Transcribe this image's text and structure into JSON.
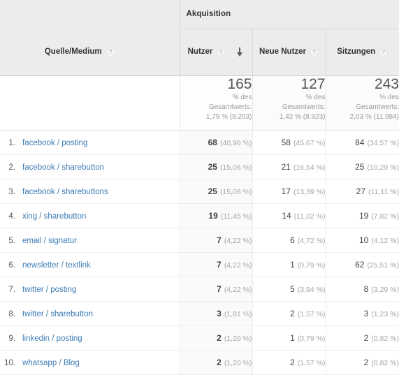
{
  "table": {
    "group_header": {
      "label": "Akquisition"
    },
    "dimension_header": {
      "label": "Quelle/Medium",
      "help_icon": "help-icon"
    },
    "metrics": [
      {
        "label": "Nutzer",
        "help_icon": "help-icon",
        "sorted": true,
        "sort_direction": "descending",
        "sort_icon": "arrow-down-icon"
      },
      {
        "label": "Neue Nutzer",
        "help_icon": "help-icon",
        "sorted": false
      },
      {
        "label": "Sitzungen",
        "help_icon": "help-icon",
        "sorted": false
      }
    ],
    "totals": [
      {
        "value": "165",
        "pct_label": "% des",
        "total_label": "Gesamtwerts:",
        "share": "1,79 % (9.203)"
      },
      {
        "value": "127",
        "pct_label": "% des",
        "total_label": "Gesamtwerts:",
        "share": "1,42 % (8.923)"
      },
      {
        "value": "243",
        "pct_label": "% des",
        "total_label": "Gesamtwerts:",
        "share": "2,03 % (11.984)"
      }
    ],
    "rows": [
      {
        "rank": "1.",
        "source": "facebook / posting",
        "users": "68",
        "users_pct": "(40,96 %)",
        "new_users": "58",
        "new_users_pct": "(45,67 %)",
        "sessions": "84",
        "sessions_pct": "(34,57 %)"
      },
      {
        "rank": "2.",
        "source": "facebook / sharebutton",
        "users": "25",
        "users_pct": "(15,06 %)",
        "new_users": "21",
        "new_users_pct": "(16,54 %)",
        "sessions": "25",
        "sessions_pct": "(10,29 %)"
      },
      {
        "rank": "3.",
        "source": "facebook / sharebuttons",
        "users": "25",
        "users_pct": "(15,06 %)",
        "new_users": "17",
        "new_users_pct": "(13,39 %)",
        "sessions": "27",
        "sessions_pct": "(11,11 %)"
      },
      {
        "rank": "4.",
        "source": "xing / sharebutton",
        "users": "19",
        "users_pct": "(11,45 %)",
        "new_users": "14",
        "new_users_pct": "(11,02 %)",
        "sessions": "19",
        "sessions_pct": "(7,82 %)"
      },
      {
        "rank": "5.",
        "source": "email / signatur",
        "users": "7",
        "users_pct": "(4,22 %)",
        "new_users": "6",
        "new_users_pct": "(4,72 %)",
        "sessions": "10",
        "sessions_pct": "(4,12 %)"
      },
      {
        "rank": "6.",
        "source": "newsletter / textlink",
        "users": "7",
        "users_pct": "(4,22 %)",
        "new_users": "1",
        "new_users_pct": "(0,79 %)",
        "sessions": "62",
        "sessions_pct": "(25,51 %)"
      },
      {
        "rank": "7.",
        "source": "twitter / posting",
        "users": "7",
        "users_pct": "(4,22 %)",
        "new_users": "5",
        "new_users_pct": "(3,94 %)",
        "sessions": "8",
        "sessions_pct": "(3,29 %)"
      },
      {
        "rank": "8.",
        "source": "twitter / sharebutton",
        "users": "3",
        "users_pct": "(1,81 %)",
        "new_users": "2",
        "new_users_pct": "(1,57 %)",
        "sessions": "3",
        "sessions_pct": "(1,23 %)"
      },
      {
        "rank": "9.",
        "source": "linkedin / posting",
        "users": "2",
        "users_pct": "(1,20 %)",
        "new_users": "1",
        "new_users_pct": "(0,79 %)",
        "sessions": "2",
        "sessions_pct": "(0,82 %)"
      },
      {
        "rank": "10.",
        "source": "whatsapp / Blog",
        "users": "2",
        "users_pct": "(1,20 %)",
        "new_users": "2",
        "new_users_pct": "(1,57 %)",
        "sessions": "2",
        "sessions_pct": "(0,82 %)"
      }
    ]
  },
  "colors": {
    "link": "#3c7cb4",
    "header_bg": "#ececec",
    "text": "#444444",
    "muted": "#a6a6a6"
  }
}
